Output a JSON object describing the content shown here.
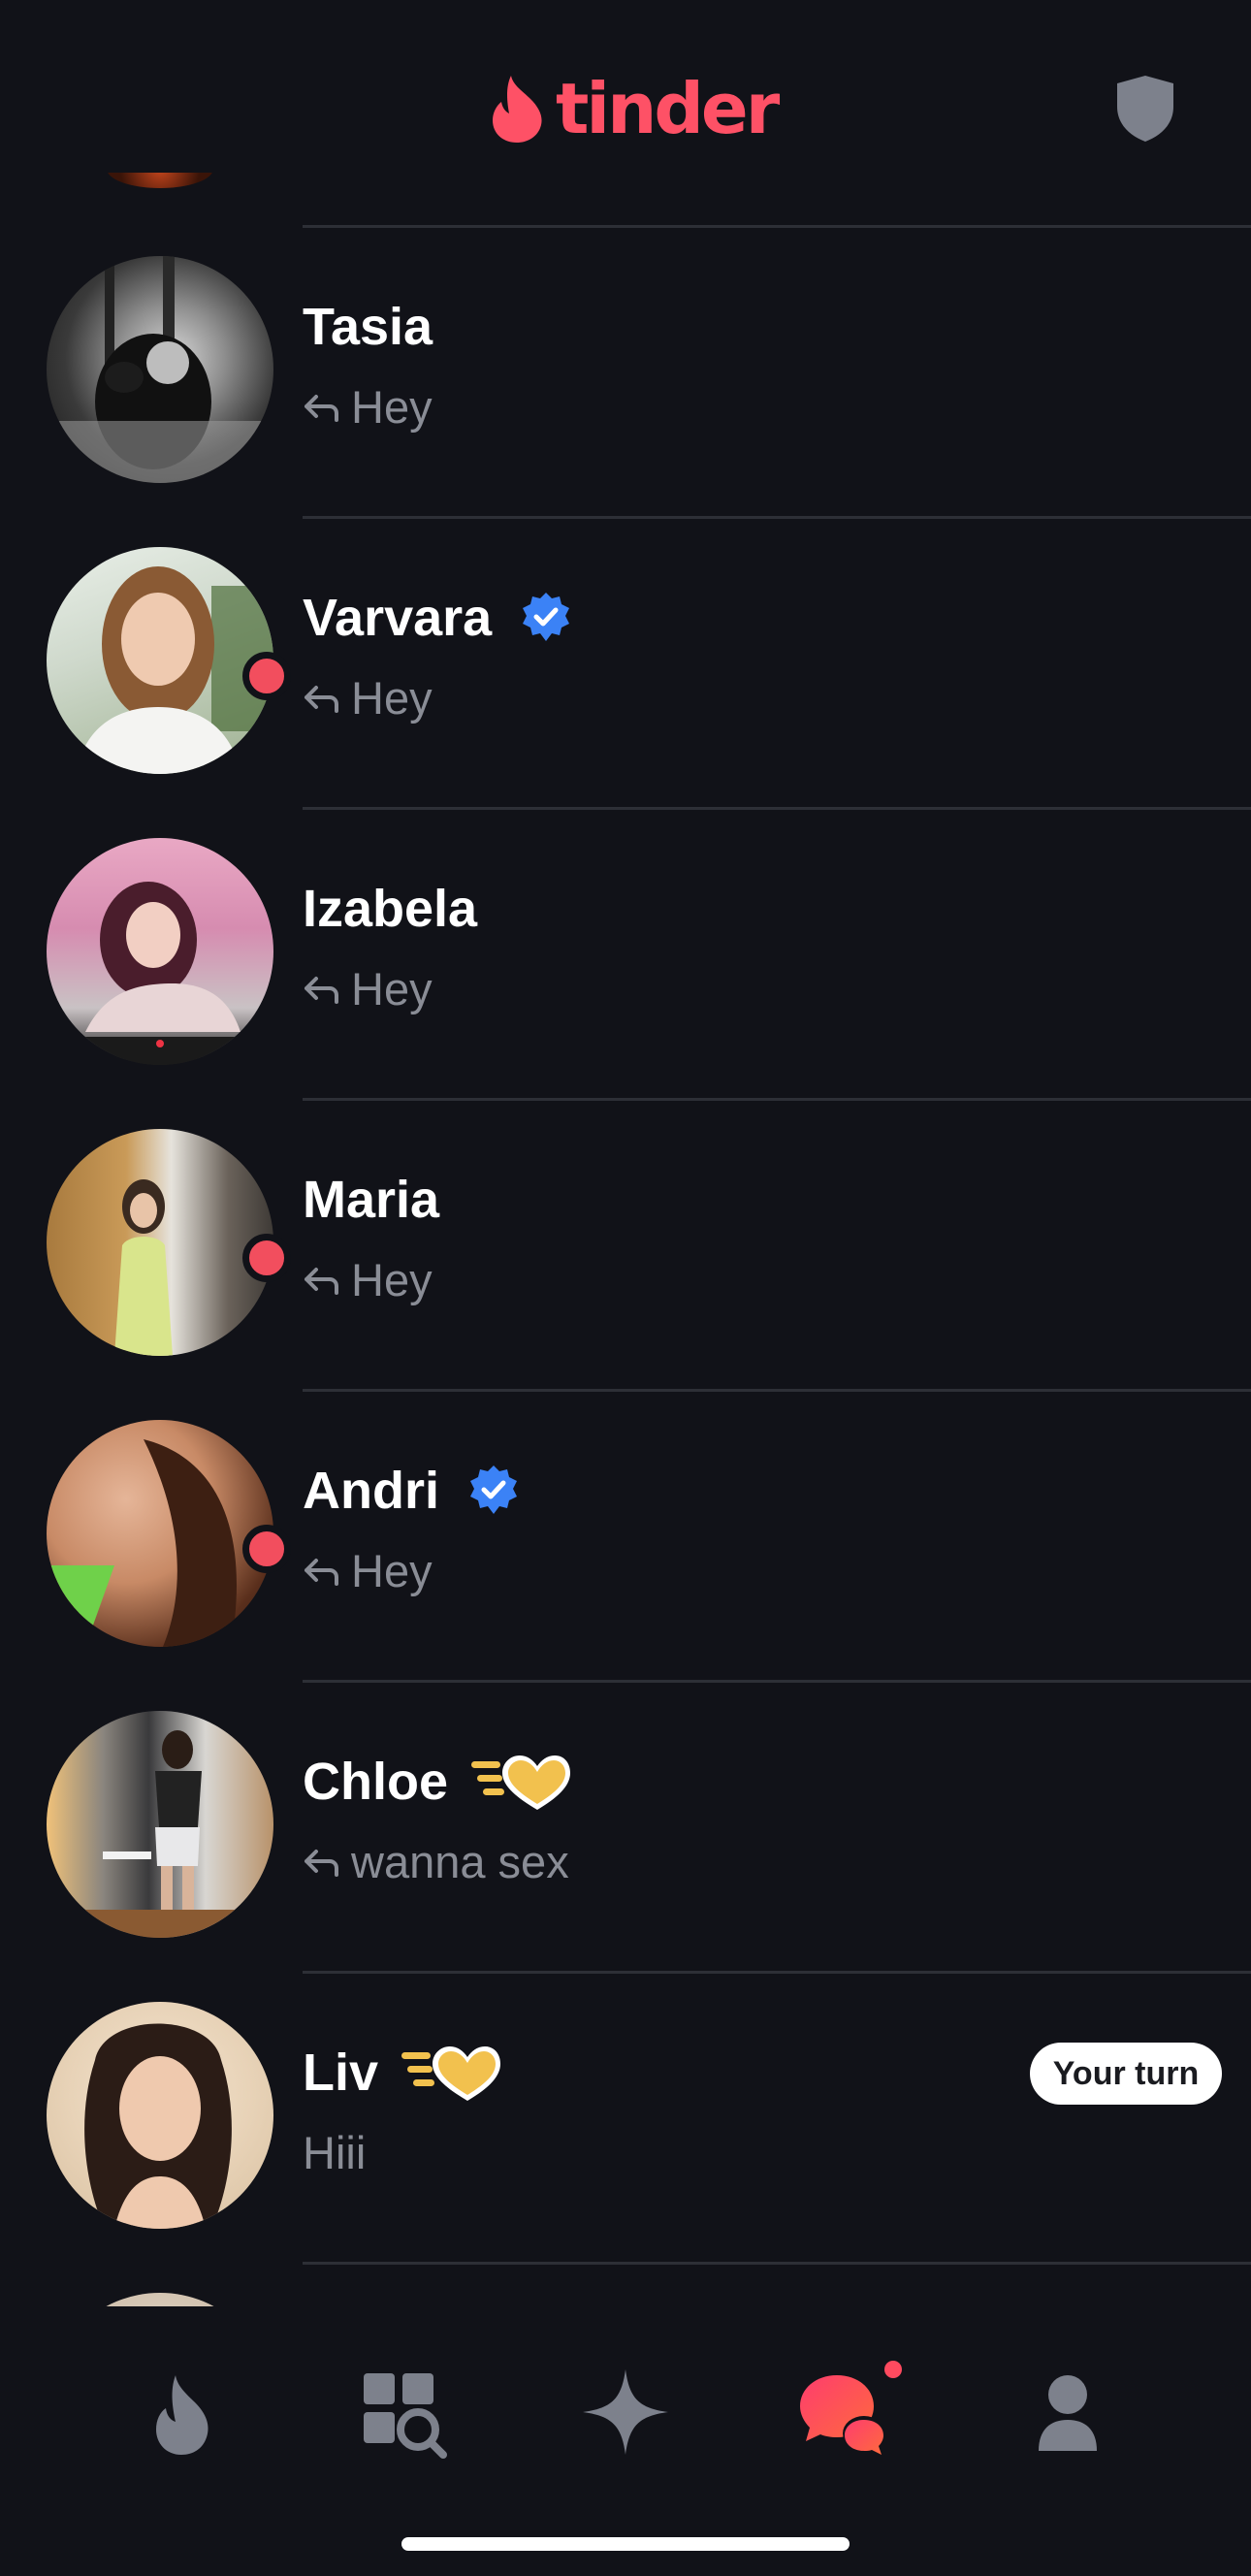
{
  "header": {
    "brand": "tinder",
    "logo_icon": "flame-icon",
    "safety_icon": "shield-icon"
  },
  "colors": {
    "background": "#111218",
    "brand": "#fe5166",
    "verified": "#3b82f6",
    "online": "#f24e5e",
    "muted_text": "#8a8d96",
    "super_like": "#f2c14e"
  },
  "conversations": [
    {
      "name": "Tasia",
      "message": "Hey",
      "online": false,
      "verified": false,
      "super_like": false,
      "reply_arrow": true,
      "your_turn": ""
    },
    {
      "name": "Varvara",
      "message": "Hey",
      "online": true,
      "verified": true,
      "super_like": false,
      "reply_arrow": true,
      "your_turn": ""
    },
    {
      "name": "Izabela",
      "message": "Hey",
      "online": false,
      "verified": false,
      "super_like": false,
      "reply_arrow": true,
      "your_turn": ""
    },
    {
      "name": "Maria",
      "message": "Hey",
      "online": true,
      "verified": false,
      "super_like": false,
      "reply_arrow": true,
      "your_turn": ""
    },
    {
      "name": "Andri",
      "message": "Hey",
      "online": true,
      "verified": true,
      "super_like": false,
      "reply_arrow": true,
      "your_turn": ""
    },
    {
      "name": "Chloe",
      "message": "wanna sex",
      "online": false,
      "verified": false,
      "super_like": true,
      "reply_arrow": true,
      "your_turn": ""
    },
    {
      "name": "Liv",
      "message": "Hiii",
      "online": false,
      "verified": false,
      "super_like": true,
      "reply_arrow": false,
      "your_turn": "Your turn"
    }
  ],
  "bottom_nav": [
    {
      "icon": "flame-icon",
      "active": false
    },
    {
      "icon": "explore-icon",
      "active": false
    },
    {
      "icon": "sparkle-icon",
      "active": false
    },
    {
      "icon": "chat-icon",
      "active": true,
      "badge": true
    },
    {
      "icon": "profile-icon",
      "active": false
    }
  ]
}
